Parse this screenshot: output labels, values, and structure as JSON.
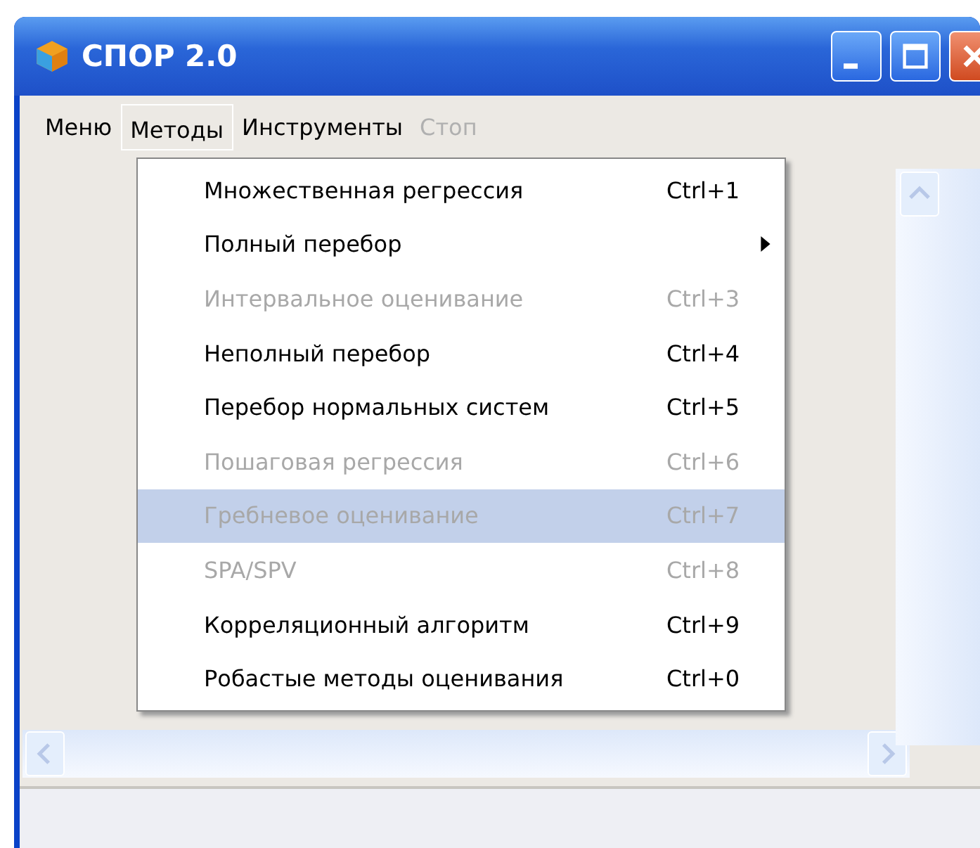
{
  "window": {
    "title": "СПОР 2.0"
  },
  "menubar": [
    {
      "label": "Меню",
      "selected": false,
      "disabled": false
    },
    {
      "label": "Методы",
      "selected": true,
      "disabled": false
    },
    {
      "label": "Инструменты",
      "selected": false,
      "disabled": false
    },
    {
      "label": "Стоп",
      "selected": false,
      "disabled": true
    }
  ],
  "menu": {
    "items": [
      {
        "kind": "command",
        "label": "Множественная регрессия",
        "shortcut": "Ctrl+1",
        "disabled": false,
        "selected": false
      },
      {
        "kind": "submenu",
        "label": "Полный перебор",
        "disabled": false,
        "selected": false
      },
      {
        "kind": "command",
        "label": "Интервальное оценивание",
        "shortcut": "Ctrl+3",
        "disabled": true,
        "selected": false
      },
      {
        "kind": "command",
        "label": "Неполный перебор",
        "shortcut": "Ctrl+4",
        "disabled": false,
        "selected": false
      },
      {
        "kind": "command",
        "label": "Перебор нормальных систем",
        "shortcut": "Ctrl+5",
        "disabled": false,
        "selected": false
      },
      {
        "kind": "command",
        "label": "Пошаговая регрессия",
        "shortcut": "Ctrl+6",
        "disabled": true,
        "selected": false
      },
      {
        "kind": "command",
        "label": "Гребневое оценивание",
        "shortcut": "Ctrl+7",
        "disabled": true,
        "selected": true
      },
      {
        "kind": "command",
        "label": "SPA/SPV",
        "shortcut": "Ctrl+8",
        "disabled": true,
        "selected": false
      },
      {
        "kind": "command",
        "label": "Корреляционный алгоритм",
        "shortcut": "Ctrl+9",
        "disabled": false,
        "selected": false
      },
      {
        "kind": "command",
        "label": "Робастые методы оценивания",
        "shortcut": "Ctrl+0",
        "disabled": false,
        "selected": false
      }
    ]
  }
}
